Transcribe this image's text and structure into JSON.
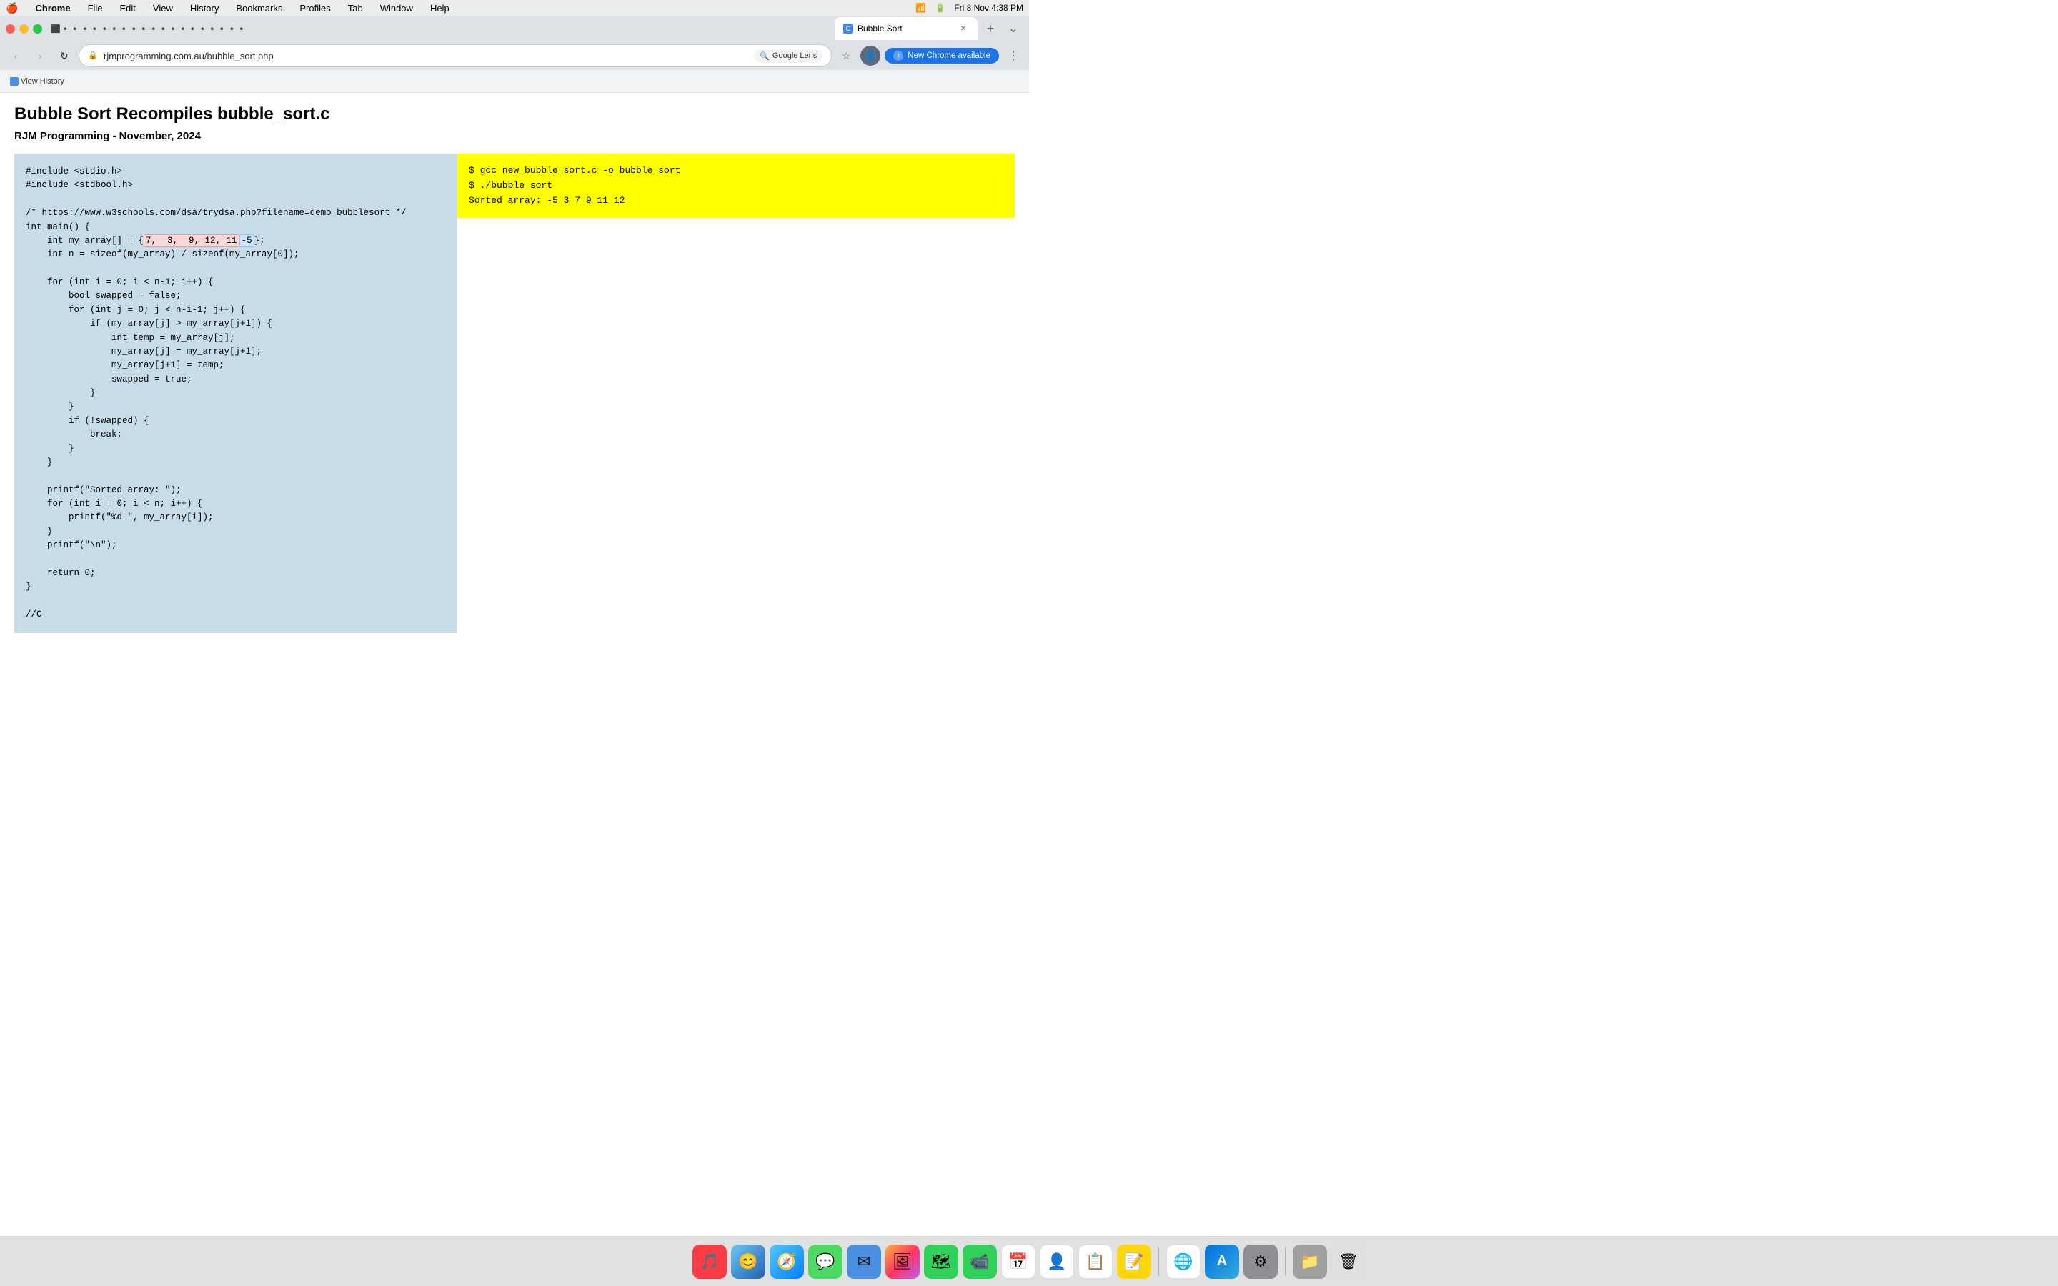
{
  "menubar": {
    "apple": "🍎",
    "items": [
      "Chrome",
      "File",
      "Edit",
      "View",
      "History",
      "Bookmarks",
      "Profiles",
      "Tab",
      "Window",
      "Help"
    ],
    "right": {
      "date_time": "Fri 8 Nov  4:38 PM"
    }
  },
  "tabs": {
    "active": {
      "title": "Bubble Sort",
      "url": "rjmprogramming.com.au/bubble_sort.php"
    },
    "new_tab_label": "+"
  },
  "toolbar": {
    "back_label": "‹",
    "forward_label": "›",
    "reload_label": "↻",
    "google_lens_label": "Google Lens",
    "new_chrome_label": "New Chrome available",
    "star_label": "☆"
  },
  "bookmarks": [
    "View History"
  ],
  "page": {
    "title": "Bubble Sort Recompiles bubble_sort.c",
    "subtitle": "RJM Programming - November, 2024",
    "code": [
      "#include <stdio.h>",
      "#include <stdbool.h>",
      "",
      "/* https://www.w3schools.com/dsa/trydsa.php?filename=demo_bubblesort */",
      "int main() {",
      "    int my_array[] = {7, 3, 9, 12, 11, -5};",
      "    int n = sizeof(my_array) / sizeof(my_array[0]);",
      "",
      "    for (int i = 0; i < n-1; i++) {",
      "        bool swapped = false;",
      "        for (int j = 0; j < n-i-1; j++) {",
      "            if (my_array[j] > my_array[j+1]) {",
      "                int temp = my_array[j];",
      "                my_array[j] = my_array[j+1];",
      "                my_array[j+1] = temp;",
      "                swapped = true;",
      "            }",
      "        }",
      "        if (!swapped) {",
      "            break;",
      "        }",
      "    }",
      "",
      "    printf(\"Sorted array: \");",
      "    for (int i = 0; i < n; i++) {",
      "        printf(\"%d \", my_array[i]);",
      "    }",
      "    printf(\"\\n\");",
      "",
      "    return 0;",
      "}",
      "",
      "//C"
    ],
    "array_highlight": "7,  3,  9, 12, 11",
    "array_negative": "-5",
    "terminal": {
      "line1": "$ gcc new_bubble_sort.c -o bubble_sort",
      "line2": "$ ./bubble_sort",
      "line3": "Sorted array: -5 3 7 9 11 12"
    }
  },
  "dock": {
    "icons": [
      {
        "name": "Music",
        "emoji": "♪",
        "color": "#fc3c44"
      },
      {
        "name": "Finder",
        "emoji": "😊",
        "color": "#4a90d9"
      },
      {
        "name": "Safari",
        "emoji": "🧭",
        "color": "#0080ff"
      },
      {
        "name": "Messages",
        "emoji": "💬",
        "color": "#4cd964"
      },
      {
        "name": "Mail",
        "emoji": "✉",
        "color": "#4a90e2"
      },
      {
        "name": "Photos",
        "emoji": "🖼",
        "color": "#ff9500"
      },
      {
        "name": "Maps",
        "emoji": "🗺",
        "color": "#30d158"
      },
      {
        "name": "FaceTime",
        "emoji": "📹",
        "color": "#30d158"
      },
      {
        "name": "Calendar",
        "emoji": "📅",
        "color": "#e8453c"
      },
      {
        "name": "Contacts",
        "emoji": "👤",
        "color": "#4a90e2"
      },
      {
        "name": "Reminders",
        "emoji": "📋",
        "color": "#e8453c"
      },
      {
        "name": "Notes",
        "emoji": "📝",
        "color": "#ffd60a"
      },
      {
        "name": "Chrome",
        "emoji": "🌐",
        "color": "#4285f4"
      },
      {
        "name": "App Store",
        "emoji": "A",
        "color": "#0071e3"
      },
      {
        "name": "System Preferences",
        "emoji": "⚙",
        "color": "#8e8e93"
      }
    ]
  }
}
